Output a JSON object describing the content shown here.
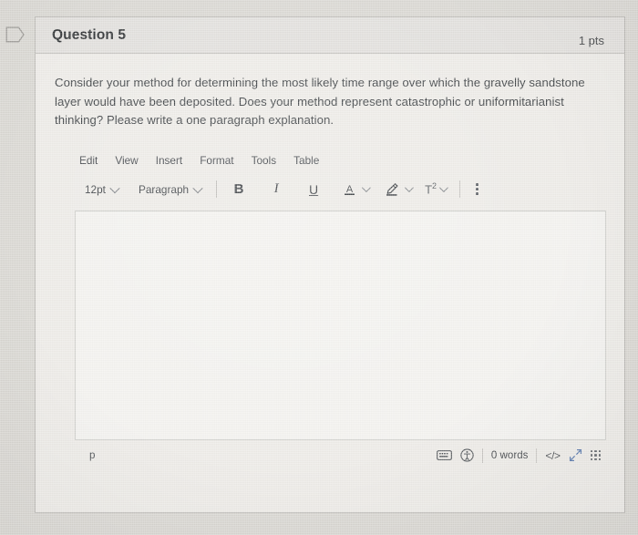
{
  "page": {
    "background_color": "#d9d7d2",
    "card_background": "#edebe7"
  },
  "marker": {
    "icon": "flag-outline-icon"
  },
  "question": {
    "title": "Question 5",
    "points": "1 pts",
    "prompt": "Consider your method for determining the most likely time range over which the gravelly sandstone layer would have been deposited. Does your method represent catastrophic or uniformitarianist thinking?  Please write a one paragraph explanation."
  },
  "editor": {
    "menubar": [
      {
        "label": "Edit"
      },
      {
        "label": "View"
      },
      {
        "label": "Insert"
      },
      {
        "label": "Format"
      },
      {
        "label": "Tools"
      },
      {
        "label": "Table"
      }
    ],
    "toolbar": {
      "font_size": "12pt",
      "block_format": "Paragraph",
      "bold_label": "B",
      "italic_label": "I",
      "underline_label": "U",
      "text_color_label": "A",
      "highlight_icon": "highlighter-pen-icon",
      "superscript_label": "T",
      "superscript_exponent": "2",
      "more_icon": "kebab-menu-icon"
    },
    "content": "",
    "status": {
      "element_path": "p",
      "keyboard_icon": "keyboard-icon",
      "accessibility_icon": "accessibility-checker-icon",
      "word_count": "0 words",
      "source_code_label": "</>",
      "fullscreen_icon": "fullscreen-arrows-icon",
      "resize_icon": "resize-grip-icon"
    }
  },
  "colors": {
    "header_band": "#e1dfdc",
    "editor_surface": "#f3f2ef",
    "accent_blue": "#4a6fa8",
    "text": "#3c4043"
  }
}
